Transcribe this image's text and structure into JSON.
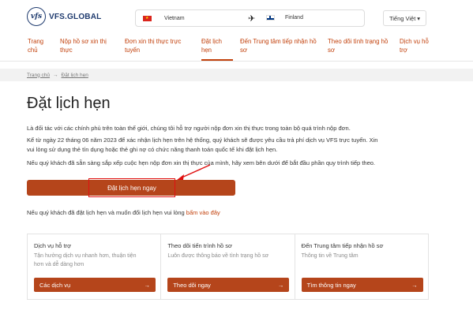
{
  "header": {
    "brand": "VFS.GLOBAL",
    "logo_mark": "vfs",
    "origin_country": "Vietnam",
    "destination_country": "Finland",
    "language": "Tiếng Việt",
    "colors": {
      "brand": "#1e3a6e",
      "accent": "#b5451b"
    }
  },
  "nav": {
    "items": [
      {
        "line1": "Trang",
        "line2": "chủ"
      },
      {
        "line1": "Nộp hồ sơ xin thị",
        "line2": "thực"
      },
      {
        "line1": "Đơn xin thị thực trực",
        "line2": "tuyến"
      },
      {
        "line1": "Đặt lịch",
        "line2": "hẹn"
      },
      {
        "line1": "Đến Trung tâm tiếp nhận hồ",
        "line2": "sơ"
      },
      {
        "line1": "Theo dõi tình trạng hồ",
        "line2": "sơ"
      },
      {
        "line1": "Dịch vụ hỗ",
        "line2": "trợ"
      }
    ]
  },
  "breadcrumb": {
    "home": "Trang chủ",
    "separator": "→",
    "current": "Đặt lịch hẹn"
  },
  "main": {
    "title": "Đặt lịch hẹn",
    "para1": "Là đối tác với các chính phủ trên toàn thế giới, chúng tôi hỗ trợ người nộp đơn xin thị thực trong toàn bộ quá trình nộp đơn.",
    "para2a": "Kể từ ngày 22 tháng 06 năm 2023 để xác nhận lịch hẹn trên hệ thống, quý khách sẽ được yêu cầu trả phí dịch vụ VFS trực tuyến. Xin",
    "para2b": "vui lòng sử dụng thẻ tín dụng hoặc thẻ ghi nợ có chức năng thanh toán quốc tế khi đặt lịch hẹn.",
    "para3": "Nếu quý khách đã sẵn sàng sắp xếp cuộc hẹn nộp đơn xin thị thực của mình, hãy xem bên dưới để bắt đầu phần quy trình tiếp theo.",
    "cta_label": "Đặt lịch hẹn ngay",
    "reschedule_text": "Nếu quý khách đã đặt lịch hẹn và muốn đổi lịch hẹn vui lòng ",
    "reschedule_link": "bấm vào đây"
  },
  "cards": [
    {
      "title": "Dịch vụ hỗ trợ",
      "desc1": "Tận hưởng dịch vụ nhanh hơn, thuận tiện",
      "desc2": "hơn và dễ dàng hơn",
      "button": "Các dịch vụ"
    },
    {
      "title": "Theo dõi tiến trình hồ sơ",
      "desc1": "Luôn được thông báo về tình trạng hồ sơ",
      "desc2": "",
      "button": "Theo dõi ngay"
    },
    {
      "title": "Đến Trung tâm tiếp nhận hồ sơ",
      "desc1": "Thông tin về Trung tâm",
      "desc2": "",
      "button": "Tìm thông tin ngay"
    }
  ]
}
